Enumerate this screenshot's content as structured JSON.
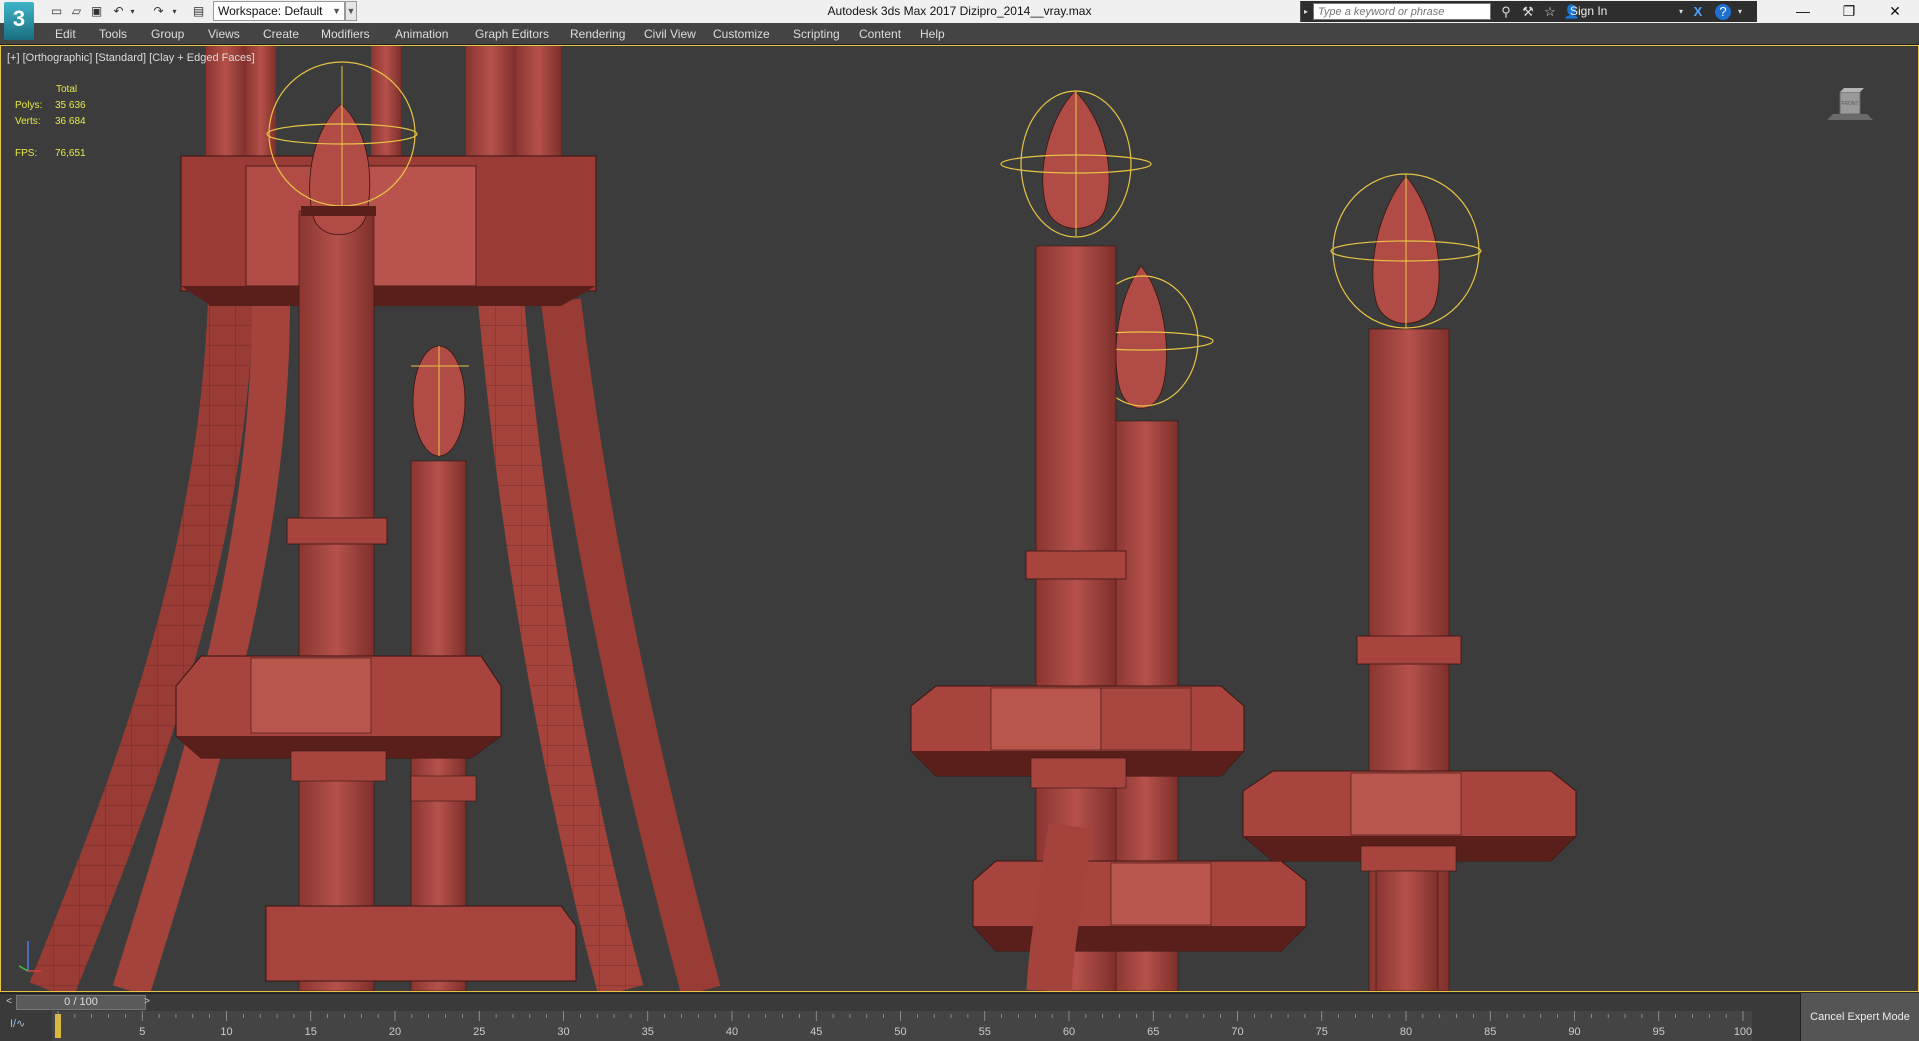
{
  "app": {
    "logo_text": "3",
    "window_title": "Autodesk 3ds Max 2017    Dizipro_2014__vray.max"
  },
  "quick_access": {
    "workspace_label": "Workspace: Default"
  },
  "infocenter": {
    "search_placeholder": "Type a keyword or phrase",
    "signin_label": "Sign In"
  },
  "menu": {
    "items": [
      "Edit",
      "Tools",
      "Group",
      "Views",
      "Create",
      "Modifiers",
      "Animation",
      "Graph Editors",
      "Rendering",
      "Civil View",
      "Customize",
      "Scripting",
      "Content",
      "Help"
    ]
  },
  "viewport": {
    "label": "[+] [Orthographic] [Standard] [Clay + Edged Faces]",
    "stats": {
      "header": "Total",
      "polys_label": "Polys:",
      "polys_value": "35 636",
      "verts_label": "Verts:",
      "verts_value": "36 684",
      "fps_label": "FPS:",
      "fps_value": "76,651"
    },
    "viewcube_label": "FRONT",
    "highlight_color": "#e7c445",
    "model_color": "#a53f38"
  },
  "timeline": {
    "frame_display": "0 / 100",
    "prev_label": "<",
    "next_label": ">",
    "ticks": [
      "5",
      "10",
      "15",
      "20",
      "25",
      "30",
      "35",
      "40",
      "45",
      "50",
      "55",
      "60",
      "65",
      "70",
      "75",
      "80",
      "85",
      "90",
      "95",
      "100"
    ]
  },
  "status": {
    "cancel_expert_label": "Cancel Expert Mode"
  }
}
